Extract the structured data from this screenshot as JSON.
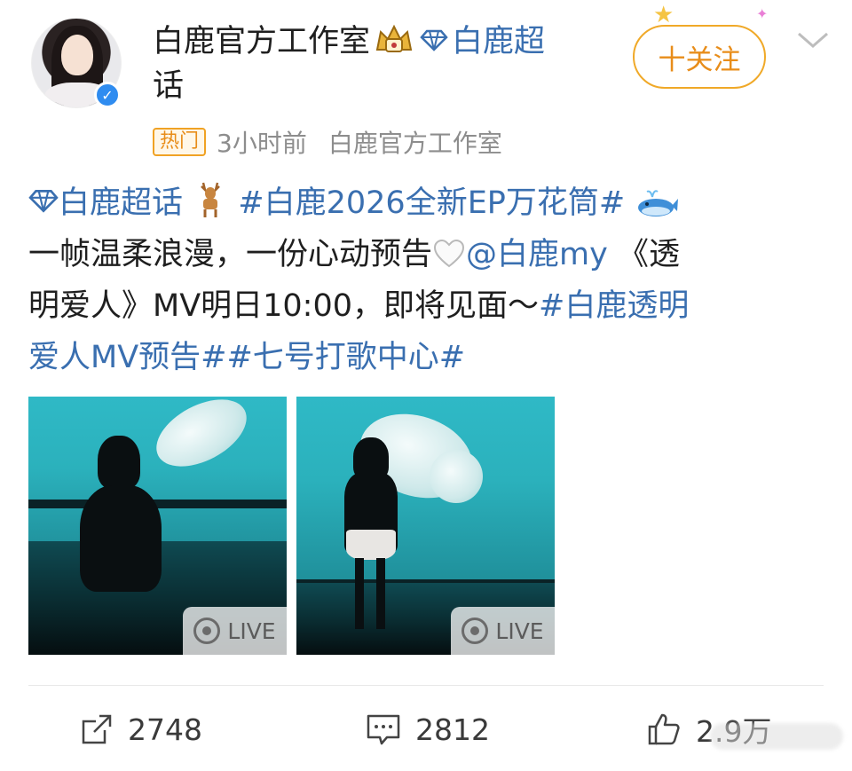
{
  "header": {
    "author_name": "白鹿官方工作室",
    "super_topic_label": "白鹿超",
    "super_topic_label_wrap": "话",
    "follow_label": "十关注",
    "hot_tag": "热门",
    "time": "3小时前",
    "source": "白鹿官方工作室"
  },
  "post": {
    "topic_link": "白鹿超话",
    "hashtag_ep": "#白鹿2026全新EP万花筒#",
    "line2_text": "一帧温柔浪漫，一份心动预告",
    "mention": "@白鹿my",
    "line2_title_start": "《透",
    "line3_text": "明爱人》MV明日10:00，即将见面～",
    "hashtag_mv_start": "#白鹿透明",
    "hashtag_mv_end": "爱人MV预告#",
    "hashtag_center": "#七号打歌中心#"
  },
  "photos": [
    {
      "live_label": "LIVE"
    },
    {
      "live_label": "LIVE"
    }
  ],
  "actions": {
    "repost_count": "2748",
    "comment_count": "2812",
    "like_count": "2.9万"
  },
  "colors": {
    "link_blue": "#3a6fb0",
    "follow_orange": "#f0a928",
    "verified_blue": "#2f8cf0"
  },
  "icons": [
    "crown-badge-icon",
    "super-topic-diamond-icon",
    "chevron-down-icon",
    "verified-icon",
    "deer-emoji-icon",
    "whale-emoji-icon",
    "white-heart-emoji-icon",
    "live-icon",
    "repost-icon",
    "comment-icon",
    "like-icon"
  ]
}
